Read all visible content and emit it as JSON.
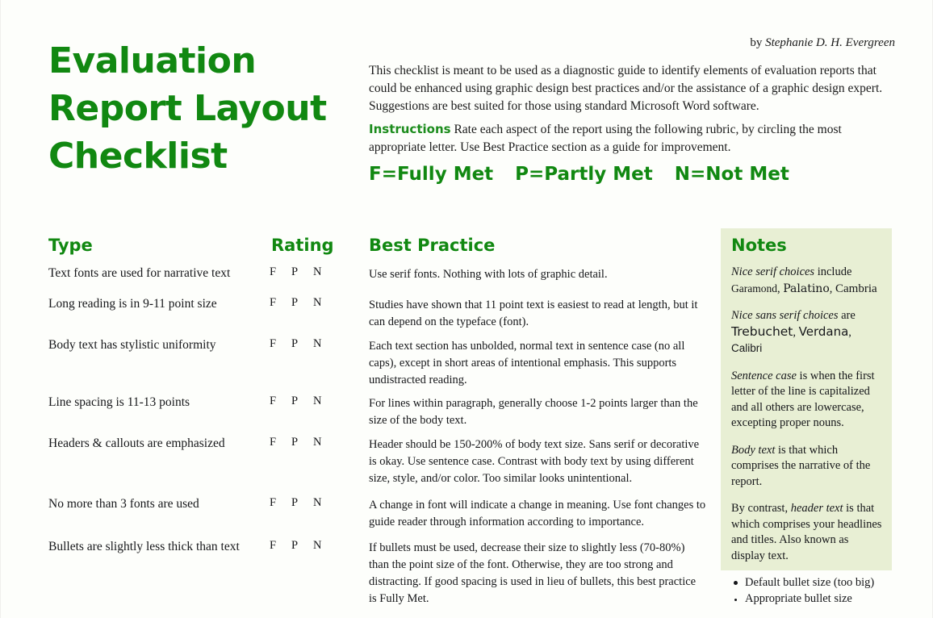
{
  "document": {
    "title": "Evaluation Report Layout Checklist",
    "byline_prefix": "by ",
    "byline_author": "Stephanie D. H. Evergreen",
    "intro": "This checklist is meant to be used as a diagnostic guide to identify elements of evaluation reports that could be enhanced using graphic design best practices and/or the assistance of a graphic design expert. Suggestions are best suited for those using standard Microsoft Word software.",
    "instructions_label": "Instructions",
    "instructions_text": "Rate each aspect of the report using the following rubric, by circling the most appropriate letter. Use Best Practice section as a guide for improvement.",
    "accent_green": "#118811",
    "notes_panel_bg": "#e8efd4",
    "page_bg": "#fdfefb"
  },
  "rubric": {
    "fully": "F=Fully Met",
    "partly": "P=Partly Met",
    "not": "N=Not Met"
  },
  "table": {
    "headers": {
      "type": "Type",
      "rating": "Rating",
      "best_practice": "Best Practice"
    },
    "rating_options": [
      "F",
      "P",
      "N"
    ],
    "rows": [
      {
        "type": "Text fonts are used for narrative text",
        "ratings": [
          "F",
          "P",
          "N"
        ],
        "best_practice": "Use serif fonts. Nothing with lots of graphic detail."
      },
      {
        "type": "Long reading is in 9-11 point size",
        "ratings": [
          "F",
          "P",
          "N"
        ],
        "best_practice": "Studies have shown that 11 point text is easiest to read at length, but it can depend on the typeface (font)."
      },
      {
        "type": "Body text has stylistic uniformity",
        "ratings": [
          "F",
          "P",
          "N"
        ],
        "best_practice": "Each text section has unbolded, normal text in sentence case (no all caps), except in short areas of intentional emphasis. This supports undistracted reading."
      },
      {
        "type": "Line spacing is 11-13 points",
        "ratings": [
          "F",
          "P",
          "N"
        ],
        "best_practice": "For lines within paragraph, generally choose 1-2 points larger than the size of the body text."
      },
      {
        "type": "Headers & callouts are emphasized",
        "ratings": [
          "F",
          "P",
          "N"
        ],
        "best_practice": "Header should be 150-200% of body text size. Sans serif or decorative is okay. Use sentence case. Contrast with body text by using different size, style, and/or color. Too similar looks unintentional."
      },
      {
        "type": "No more than 3 fonts are used",
        "ratings": [
          "F",
          "P",
          "N"
        ],
        "best_practice": "A change in font will indicate a change in meaning. Use font changes to guide reader through information according to importance."
      },
      {
        "type": "Bullets are slightly less thick than text",
        "ratings": [
          "F",
          "P",
          "N"
        ],
        "best_practice": "If bullets must be used, decrease their size to slightly less (70-80%) than the point size of the font. Otherwise, they are too strong and distracting. If good spacing is used in lieu of bullets, this best practice is Fully Met."
      }
    ]
  },
  "notes": {
    "heading": "Notes",
    "serif_label": "Nice serif choices",
    "serif_after": " include",
    "serif_samples": [
      "Garamond",
      "Palatino",
      "Cambria"
    ],
    "sans_label": "Nice sans serif choices",
    "sans_after": " are",
    "sans_samples": [
      "Trebuchet",
      "Verdana",
      "Calibri"
    ],
    "sentence_case_label": "Sentence case",
    "sentence_case_text": " is when the first letter of the line is capitalized and all others are lowercase, excepting proper nouns.",
    "body_text_label": "Body text",
    "body_text_text": " is that which comprises the narrative of the report.",
    "header_text_prefix": "By contrast, ",
    "header_text_label": "header text",
    "header_text_text": " is that which comprises your headlines and titles. Also known as display text.",
    "bullets": [
      {
        "label": "Default bullet size (too big)",
        "size": "big"
      },
      {
        "label": "Appropriate bullet size",
        "size": "small"
      }
    ]
  }
}
